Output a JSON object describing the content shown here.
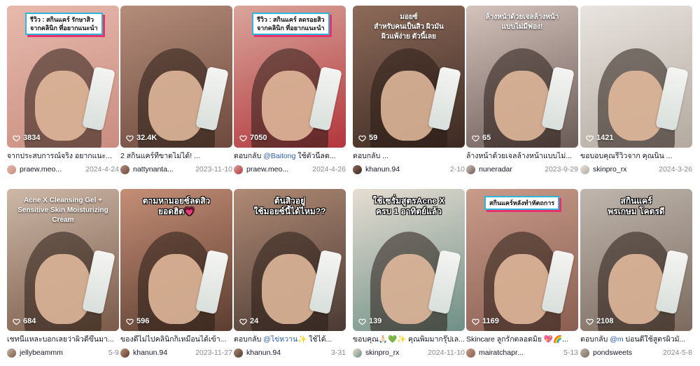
{
  "videos": [
    {
      "likes": "3834",
      "overlay": "รีวิว : สกินแคร์ รักษาสิว\nจากคลินิก ที่อยากแนะนำ",
      "desc_prefix": "",
      "desc_mention": "",
      "desc": "จากประสบการณ์จริง อยากแนะ...",
      "author": "praew.meo...",
      "date": "2024-4-24",
      "colors": {
        "bg": "#e7b9ad",
        "bg2": "#c98d80"
      }
    },
    {
      "likes": "32.4K",
      "overlay": "",
      "desc_prefix": "",
      "desc_mention": "",
      "desc": "2 สกินแคร์ที่ขาดไม่ได้! ...",
      "author": "nattynanta...",
      "date": "2023-11-10",
      "colors": {
        "bg": "#b48c7a",
        "bg2": "#6d4a3d"
      }
    },
    {
      "likes": "7050",
      "overlay": "รีวิว : สกินแคร์ ลดรอยสิว\nจากคลินิก ที่อยากแนะนำ",
      "desc_prefix": "ตอบกลับ ",
      "desc_mention": "@Baitong",
      "desc": " ใช้ตัวนี้ลด...",
      "author": "praew.meo...",
      "date": "2024-4-26",
      "colors": {
        "bg": "#d9a59b",
        "bg2": "#b3363d"
      }
    },
    {
      "likes": "59",
      "overlay": "มอยซ์\nสำหรับคนเป็นสิว ผิวมัน\nผิวแพ้ง่าย ตัวนี้เลย",
      "desc_prefix": "ตอบกลับ ",
      "desc_mention": "",
      "desc": "...",
      "author": "khanun.94",
      "date": "2-10",
      "colors": {
        "bg": "#8e6b5a",
        "bg2": "#3c2a22"
      }
    },
    {
      "likes": "65",
      "overlay": "ล้างหน้าด้วยเจลล้างหน้า\nแบบไม่มีฟอง!",
      "desc_prefix": "",
      "desc_mention": "",
      "desc": "ล้างหน้าด้วยเจลล้างหน้าแบบไม่...",
      "author": "nuneradar",
      "date": "2023-9-29",
      "colors": {
        "bg": "#d4c2bc",
        "bg2": "#6b5b56"
      }
    },
    {
      "likes": "1421",
      "overlay": "",
      "desc_prefix": "",
      "desc_mention": "",
      "desc": "ขอบอบคุณรีวิวจาก คุณนิน ...",
      "author": "skinpro_rx",
      "date": "2024-3-26",
      "colors": {
        "bg": "#e9e4df",
        "bg2": "#b3a99f"
      }
    },
    {
      "likes": "684",
      "overlay": "Acne X Cleansing Gel +\nSensitive Skin Moisturizing\nCream",
      "desc_prefix": "",
      "desc_mention": "",
      "desc": "เชทนี้แหละบอกเลยว่าผิวดีขึ้นมา...",
      "author": "jellybeammm",
      "date": "5-9",
      "colors": {
        "bg": "#cdb8a8",
        "bg2": "#7a5a48"
      }
    },
    {
      "likes": "596",
      "overlay": "ตามหามอยซ์ลดสิว\nยอดฮิต💗",
      "desc_prefix": "",
      "desc_mention": "",
      "desc": "ของดีไม่ไปคลินิกก็เหมือนได้เข้า...",
      "author": "khanun.94",
      "date": "2023-11-27",
      "colors": {
        "bg": "#c58e76",
        "bg2": "#5b3d30"
      }
    },
    {
      "likes": "24",
      "overlay": "ต้นสิวอยู่\nใช้มอยซ์นี้ได้ไหม??",
      "desc_prefix": "ตอบกลับ ",
      "desc_mention": "@ไข่หวาน",
      "desc": "✨ ใช้ได้...",
      "author": "khanun.94",
      "date": "3-31",
      "colors": {
        "bg": "#b08a75",
        "bg2": "#4a3a33"
      }
    },
    {
      "likes": "139",
      "overlay": "ใช้เซรั่มสูตรAcne X\nครบ 1 อาทิตย์แล้ว",
      "desc_prefix": "",
      "desc_mention": "",
      "desc": "ขอบคุณ🙏🏻💚✨ คุณพิมมากรุ๊ปเล...",
      "author": "skinpro_rx",
      "date": "2024-11-10",
      "colors": {
        "bg": "#e6ddd2",
        "bg2": "#6e8f86"
      }
    },
    {
      "likes": "1169",
      "overlay": "สกินแคร์หลังทำหัตถการ",
      "desc_prefix": "",
      "desc_mention": "",
      "desc": "Skincare ลูกรักตลอดมิ่ย 💖🌈...",
      "author": "mairatchapr...",
      "date": "5-13",
      "colors": {
        "bg": "#c89b8a",
        "bg2": "#8a5f52"
      }
    },
    {
      "likes": "2108",
      "overlay": "สกินแคร์\nพรเกษม โคตรดี",
      "desc_prefix": "ตอบกลับ ",
      "desc_mention": "@m",
      "desc": " บ่อนดีใช้สูตรผิวมั...",
      "author": "pondsweets",
      "date": "2024-5-8",
      "colors": {
        "bg": "#bfb6ad",
        "bg2": "#7c6a5e"
      }
    }
  ]
}
